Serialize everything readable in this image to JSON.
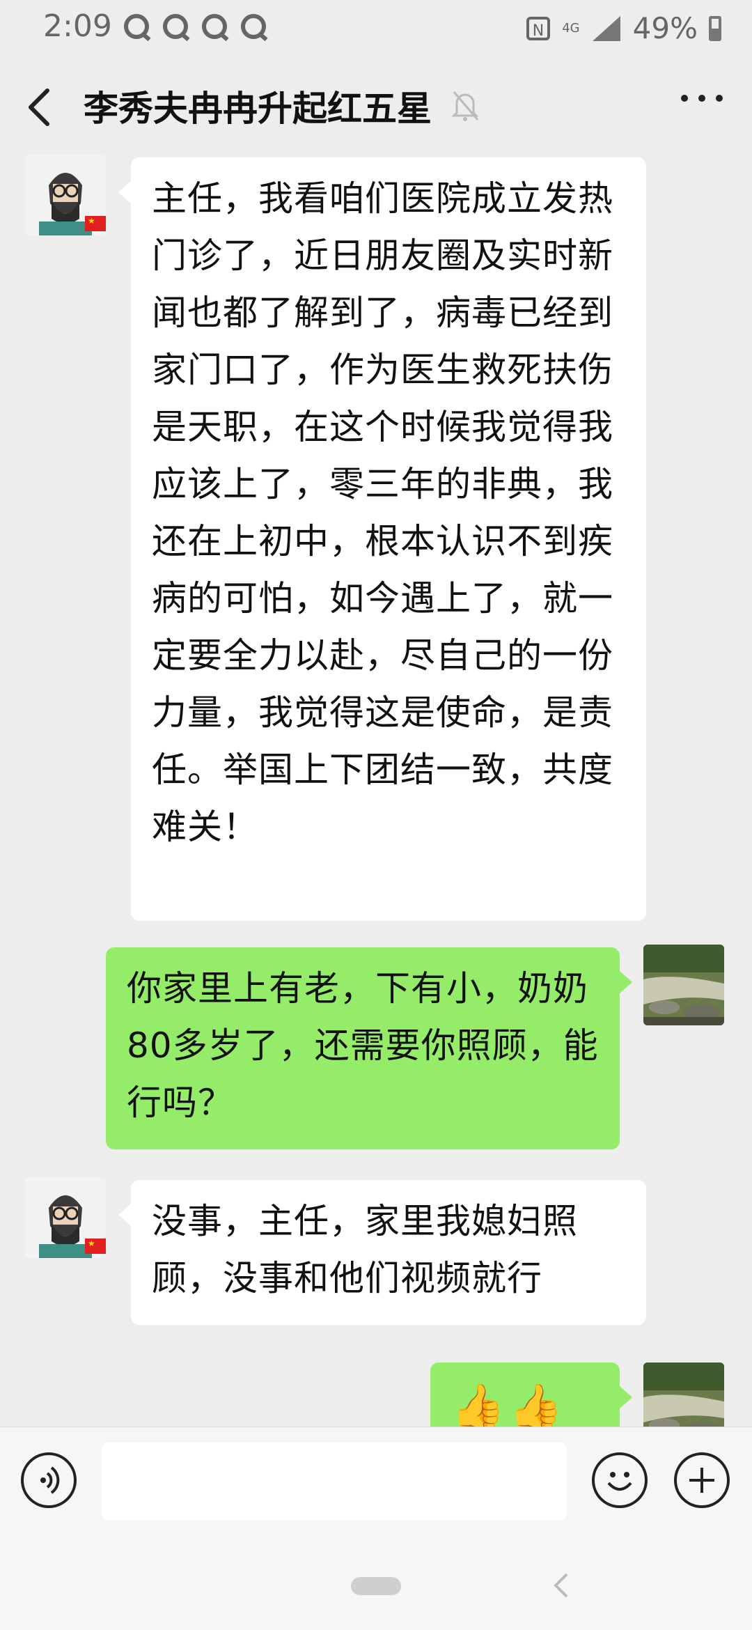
{
  "status_bar": {
    "time": "2:09",
    "network": "4G",
    "battery": "49%"
  },
  "header": {
    "title": "李秀夫冉冉升起红五星"
  },
  "messages": [
    {
      "direction": "in",
      "text": "主任，我看咱们医院成立发热门诊了，近日朋友圈及实时新闻也都了解到了，病毒已经到家门口了，作为医生救死扶伤是天职，在这个时候我觉得我应该上了，零三年的非典，我还在上初中，根本认识不到疾病的可怕，如今遇上了，就一定要全力以赴，尽自己的一份力量，我觉得这是使命，是责任。举国上下团结一致，共度难关！"
    },
    {
      "direction": "out",
      "text": "你家里上有老，下有小，奶奶80多岁了，还需要你照顾，能行吗？"
    },
    {
      "direction": "in",
      "text": "没事，主任，家里我媳妇照顾，没事和他们视频就行"
    },
    {
      "direction": "out",
      "text": "👍👍👍"
    }
  ],
  "colors": {
    "incoming_bubble": "#ffffff",
    "outgoing_bubble": "#95ec69",
    "background": "#ededed"
  },
  "icons": [
    "back-arrow-icon",
    "mute-bell-icon",
    "more-icon",
    "voice-icon",
    "emoji-icon",
    "plus-icon",
    "flag-badge-icon"
  ]
}
